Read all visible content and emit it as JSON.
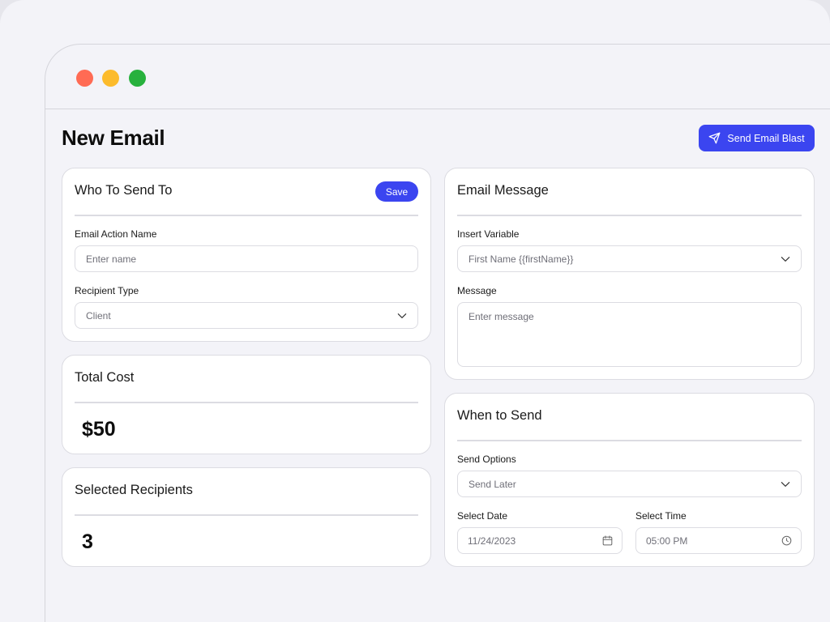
{
  "header": {
    "title": "New Email",
    "send_button_label": "Send Email Blast",
    "send_icon": "paper-plane-icon"
  },
  "who_to_send": {
    "title": "Who To Send To",
    "save_label": "Save",
    "action_name_label": "Email Action Name",
    "action_name_placeholder": "Enter name",
    "recipient_type_label": "Recipient Type",
    "recipient_type_value": "Client"
  },
  "total_cost": {
    "title": "Total Cost",
    "value": "$50"
  },
  "selected_recipients": {
    "title": "Selected Recipients",
    "value": "3"
  },
  "email_message": {
    "title": "Email Message",
    "insert_variable_label": "Insert Variable",
    "insert_variable_value": "First Name {{firstName}}",
    "message_label": "Message",
    "message_placeholder": "Enter message"
  },
  "when_to_send": {
    "title": "When to Send",
    "send_options_label": "Send Options",
    "send_options_value": "Send Later",
    "date_label": "Select Date",
    "date_value": "11/24/2023",
    "time_label": "Select Time",
    "time_value": "05:00 PM"
  },
  "colors": {
    "accent": "#3b45f0",
    "traffic_red": "#ff6b54",
    "traffic_yellow": "#fcbb2c",
    "traffic_green": "#27b13d"
  }
}
